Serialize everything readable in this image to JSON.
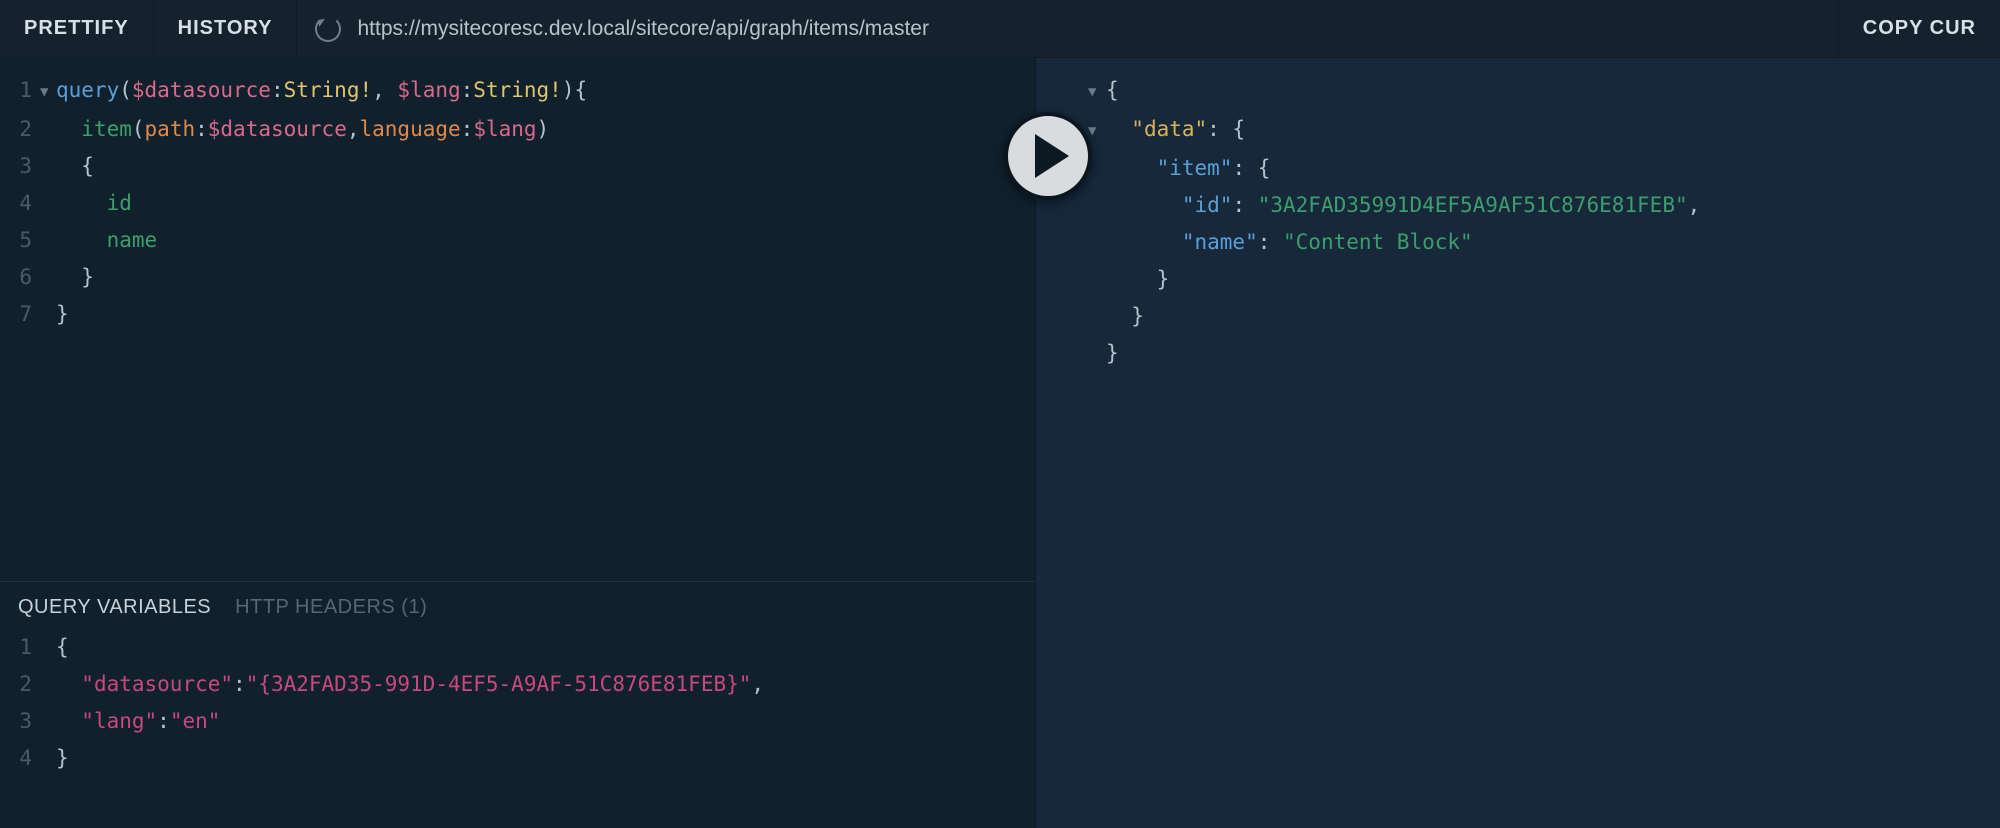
{
  "toolbar": {
    "prettify_label": "PRETTIFY",
    "history_label": "HISTORY",
    "endpoint_url": "https://mysitecoresc.dev.local/sitecore/api/graph/items/master",
    "copy_curl_label": "COPY CUR"
  },
  "query_editor": {
    "tokens": {
      "kw_query": "query",
      "var_datasource": "$datasource",
      "type_string_bang": "String!",
      "var_lang": "$lang",
      "field_item": "item",
      "arg_path": "path",
      "arg_language": "language",
      "field_id": "id",
      "field_name": "name"
    },
    "line_numbers": [
      "1",
      "2",
      "3",
      "4",
      "5",
      "6",
      "7"
    ]
  },
  "variables_panel": {
    "tab_vars_label": "QUERY VARIABLES",
    "tab_headers_label": "HTTP HEADERS (1)",
    "line_numbers": [
      "1",
      "2",
      "3",
      "4"
    ],
    "keys": {
      "datasource": "\"datasource\"",
      "lang": "\"lang\""
    },
    "values": {
      "datasource": "\"{3A2FAD35-991D-4EF5-A9AF-51C876E81FEB}\"",
      "lang": "\"en\""
    }
  },
  "result": {
    "keys": {
      "data": "\"data\"",
      "item": "\"item\"",
      "id": "\"id\"",
      "name": "\"name\""
    },
    "values": {
      "id": "\"3A2FAD35991D4EF5A9AF51C876E81FEB\"",
      "name": "\"Content Block\""
    }
  },
  "icons": {
    "reload": "reload-icon",
    "play": "play-icon"
  }
}
